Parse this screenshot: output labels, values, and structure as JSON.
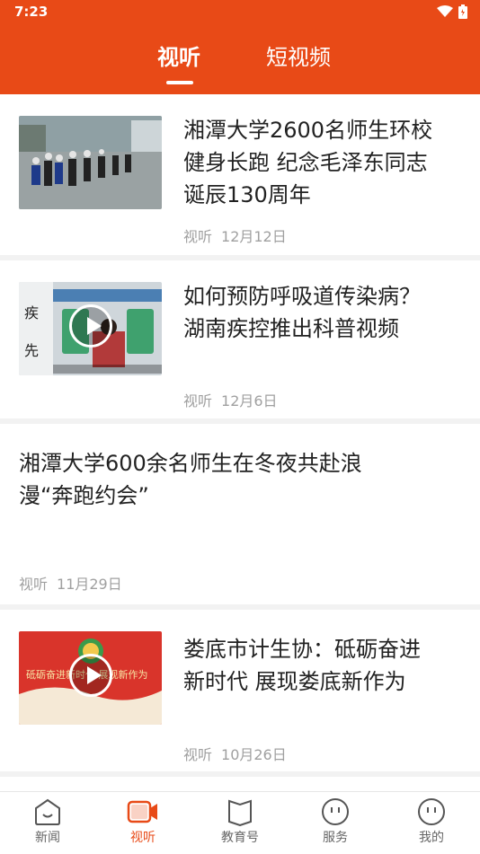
{
  "status_bar": {
    "time": "7:23"
  },
  "tabs": [
    {
      "label": "视听",
      "active": true
    },
    {
      "label": "短视频",
      "active": false
    }
  ],
  "colors": {
    "accent": "#e84a17",
    "meta_text": "#a0a0a0"
  },
  "feed": [
    {
      "title": "湘潭大学2600名师生环校健身长跑 纪念毛泽东同志诞辰130周年",
      "title_lines": [
        "湘潭大学2600名师生环校",
        "健身长跑 纪念毛泽东同志",
        "诞辰130周年"
      ],
      "source": "视听",
      "date": "12月12日",
      "has_thumb": true,
      "is_video": false
    },
    {
      "title": "如何预防呼吸道传染病？湖南疾控推出科普视频",
      "title_lines": [
        "如何预防呼吸道传染病？",
        "湖南疾控推出科普视频"
      ],
      "source": "视听",
      "date": "12月6日",
      "has_thumb": true,
      "is_video": true
    },
    {
      "title": "湘潭大学600余名师生在冬夜共赴浪漫“奔跑约会”",
      "title_lines": [
        "湘潭大学600余名师生在冬夜共赴浪",
        "漫“奔跑约会”"
      ],
      "source": "视听",
      "date": "11月29日",
      "has_thumb": false,
      "is_video": false
    },
    {
      "title": "娄底市计生协：砥砺奋进新时代 展现娄底新作为",
      "title_lines": [
        "娄底市计生协：砥砺奋进",
        "新时代 展现娄底新作为"
      ],
      "source": "视听",
      "date": "10月26日",
      "has_thumb": true,
      "is_video": true
    }
  ],
  "bottom_nav": [
    {
      "label": "新闻",
      "icon": "smile-bubble-icon",
      "active": false
    },
    {
      "label": "视听",
      "icon": "video-camera-icon",
      "active": true
    },
    {
      "label": "教育号",
      "icon": "book-icon",
      "active": false
    },
    {
      "label": "服务",
      "icon": "face-icon",
      "active": false
    },
    {
      "label": "我的",
      "icon": "face-icon",
      "active": false
    }
  ]
}
